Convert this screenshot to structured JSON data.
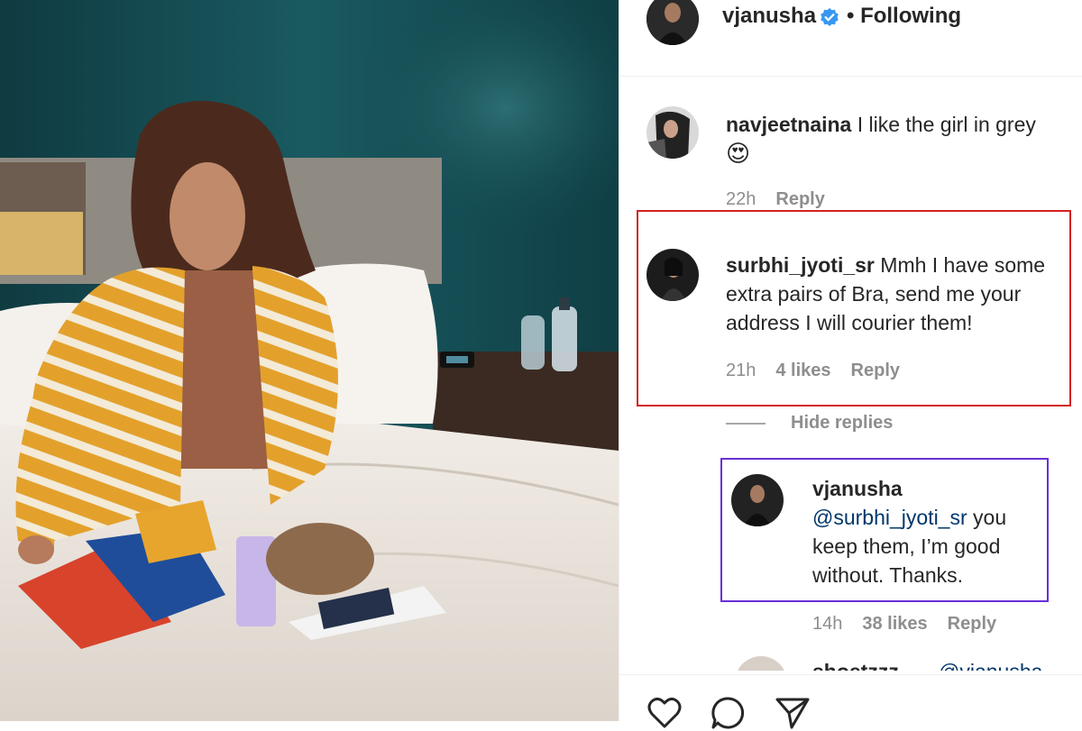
{
  "post": {
    "author": "vjanusha",
    "follow_status": "• Following"
  },
  "comments": [
    {
      "username": "navjeetnaina",
      "text": "I like the girl in grey",
      "emoji": "😍",
      "time": "22h",
      "reply_label": "Reply"
    },
    {
      "username": "surbhi_jyoti_sr",
      "text": "Mmh I have some extra pairs of Bra, send me your address I will courier them!",
      "time": "21h",
      "likes": "4 likes",
      "reply_label": "Reply",
      "hide_replies_label": "Hide replies"
    }
  ],
  "reply": {
    "username": "vjanusha",
    "mention": "@surbhi_jyoti_sr",
    "text": "you keep them, I’m good without. Thanks.",
    "time": "14h",
    "likes": "38 likes",
    "reply_label": "Reply"
  },
  "partial_comment": {
    "username": "shoetzzz",
    "mention": "@vjanusha"
  },
  "icons": {
    "like": "heart-icon",
    "comment": "comment-icon",
    "share": "share-icon",
    "verified": "verified-badge-icon"
  },
  "colors": {
    "highlight_red": "#d42020",
    "highlight_purple": "#6a2fd8",
    "verified_blue": "#3897f0",
    "mention_blue": "#00376b",
    "wall_teal": "#134b51"
  }
}
